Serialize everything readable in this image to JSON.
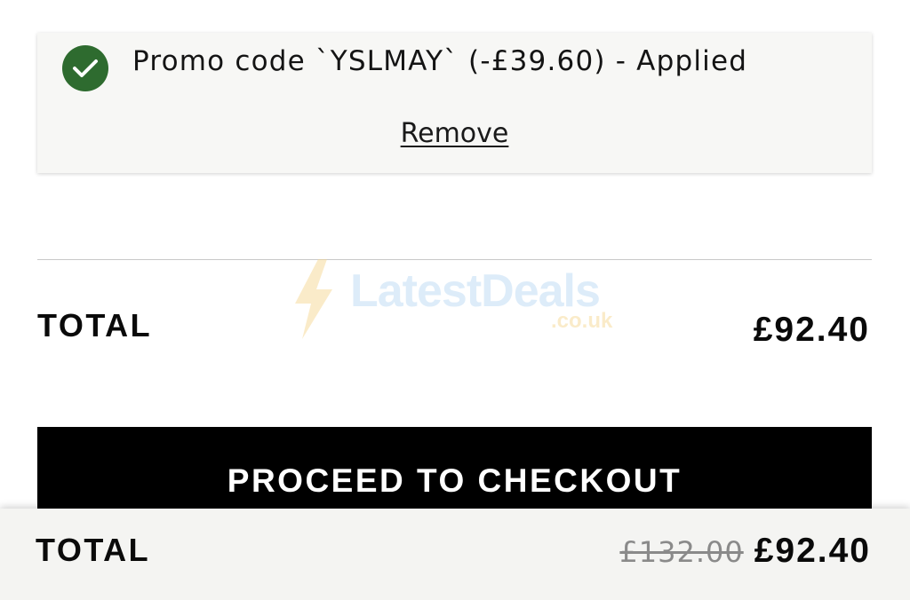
{
  "promo": {
    "message": "Promo code `YSLMAY` (-£39.60) - Applied",
    "remove_label": "Remove",
    "icon": "check-circle-icon",
    "icon_color": "#2e6b2f"
  },
  "watermark": {
    "text": "LatestDeals",
    "subtext": ".co.uk"
  },
  "summary": {
    "total_label": "TOTAL",
    "total_value": "£92.40"
  },
  "checkout": {
    "button_label": "PROCEED TO CHECKOUT"
  },
  "sticky": {
    "total_label": "TOTAL",
    "original_price": "£132.00",
    "current_price": "£92.40"
  }
}
